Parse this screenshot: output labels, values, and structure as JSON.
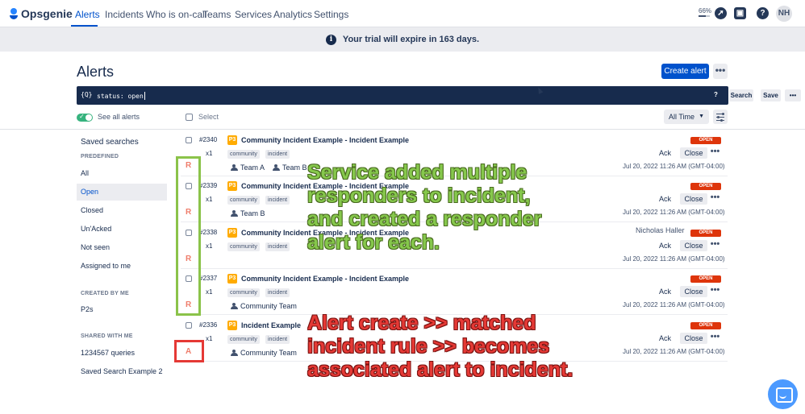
{
  "nav": {
    "brand": "Opsgenie",
    "items": [
      "Alerts",
      "Incidents",
      "Who is on-call",
      "Teams",
      "Services",
      "Analytics",
      "Settings"
    ],
    "zoom": "66%",
    "zoom_fraction": 0.66,
    "avatar": "NH"
  },
  "banner": {
    "text": "Your trial will expire in 163 days."
  },
  "header": {
    "title": "Alerts",
    "create_label": "Create alert",
    "more": "•••"
  },
  "search": {
    "icon_text": "{Q}",
    "query": "status: open",
    "help": "?",
    "search_label": "Search",
    "save_label": "Save",
    "more": "•••"
  },
  "controls": {
    "see_all": "See all alerts",
    "select": "Select",
    "time": "All Time"
  },
  "sidebar": {
    "title": "Saved searches",
    "predefined_label": "PREDEFINED",
    "predefined": [
      "All",
      "Open",
      "Closed",
      "Un'Acked",
      "Not seen",
      "Assigned to me"
    ],
    "created_label": "CREATED BY ME",
    "created": [
      "P2s"
    ],
    "shared_label": "SHARED WITH ME",
    "shared": [
      "1234567 queries",
      "Saved Search Example 2"
    ]
  },
  "alerts": [
    {
      "num": "#2340",
      "count": "x1",
      "priority": "P3",
      "message": "Community Incident Example - Incident Example",
      "tags": [
        "community",
        "incident"
      ],
      "teams": [
        "Team A",
        "Team B"
      ],
      "owner": "",
      "status": "OPEN",
      "ack": "Ack",
      "close": "Close",
      "more": "•••",
      "time": "Jul 20, 2022 11:26 AM (GMT-04:00)",
      "marker": "R"
    },
    {
      "num": "#2339",
      "count": "x1",
      "priority": "P3",
      "message": "Community Incident Example - Incident Example",
      "tags": [
        "community",
        "incident"
      ],
      "teams": [
        "Team B"
      ],
      "owner": "",
      "status": "OPEN",
      "ack": "Ack",
      "close": "Close",
      "more": "•••",
      "time": "Jul 20, 2022 11:26 AM (GMT-04:00)",
      "marker": "R"
    },
    {
      "num": "#2338",
      "count": "x1",
      "priority": "P3",
      "message": "Community Incident Example - Incident Example",
      "tags": [
        "community",
        "incident"
      ],
      "teams": [],
      "owner": "Nicholas Haller",
      "status": "OPEN",
      "ack": "Ack",
      "close": "Close",
      "more": "•••",
      "time": "Jul 20, 2022 11:26 AM (GMT-04:00)",
      "marker": "R"
    },
    {
      "num": "#2337",
      "count": "x1",
      "priority": "P3",
      "message": "Community Incident Example - Incident Example",
      "tags": [
        "community",
        "incident"
      ],
      "teams": [
        "Community Team"
      ],
      "owner": "",
      "status": "OPEN",
      "ack": "Ack",
      "close": "Close",
      "more": "•••",
      "time": "Jul 20, 2022 11:26 AM (GMT-04:00)",
      "marker": "R"
    },
    {
      "num": "#2336",
      "count": "x1",
      "priority": "P3",
      "message": "Incident Example",
      "tags": [
        "community",
        "incident"
      ],
      "teams": [
        "Community Team"
      ],
      "owner": "",
      "status": "OPEN",
      "ack": "Ack",
      "close": "Close",
      "more": "•••",
      "time": "Jul 20, 2022 11:26 AM (GMT-04:00)",
      "marker": "A"
    }
  ],
  "annotations": {
    "green_text": "Service added multiple\nresponders to incident,\nand created a responder\nalert for each.",
    "red_text": "Alert create >> matched\nincident rule >> becomes\nassociated alert to incident.",
    "green_color": "#86c84c",
    "red_color": "#e53935"
  },
  "colors": {
    "brand": "#0052cc",
    "open_status": "#de350b",
    "priority_p3": "#ffab00",
    "toggle_on": "#36b37e"
  }
}
